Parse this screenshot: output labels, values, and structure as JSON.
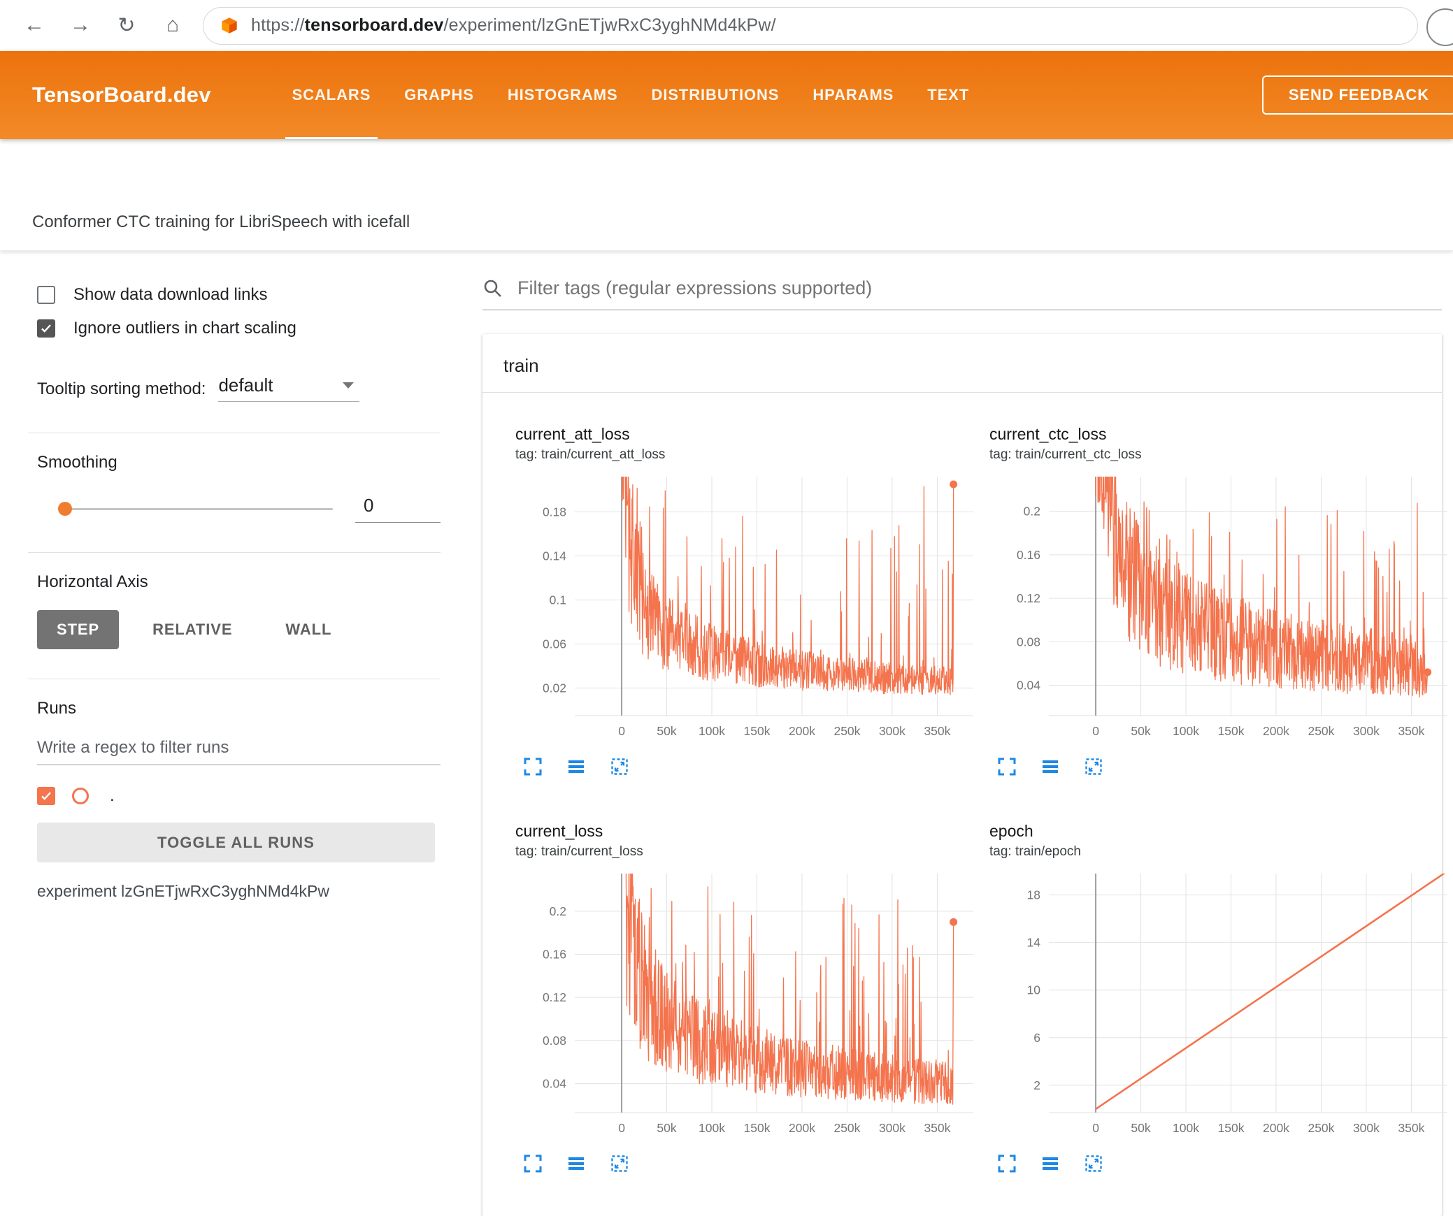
{
  "browser": {
    "back_glyph": "←",
    "forward_glyph": "→",
    "refresh_glyph": "↻",
    "home_glyph": "⌂",
    "url_scheme": "https://",
    "url_domain": "tensorboard.dev",
    "url_path": "/experiment/lzGnETjwRxC3yghNMd4kPw/"
  },
  "header": {
    "brand": "TensorBoard.dev",
    "tabs": [
      {
        "label": "SCALARS",
        "active": true
      },
      {
        "label": "GRAPHS",
        "active": false
      },
      {
        "label": "HISTOGRAMS",
        "active": false
      },
      {
        "label": "DISTRIBUTIONS",
        "active": false
      },
      {
        "label": "HPARAMS",
        "active": false
      },
      {
        "label": "TEXT",
        "active": false
      }
    ],
    "feedback_button": "SEND FEEDBACK"
  },
  "experiment_title": "Conformer CTC training for LibriSpeech with icefall",
  "sidebar": {
    "show_download_label": "Show data download links",
    "ignore_outliers_label": "Ignore outliers in chart scaling",
    "tooltip_sorting_label": "Tooltip sorting method:",
    "tooltip_sorting_value": "default",
    "smoothing_label": "Smoothing",
    "smoothing_value": "0",
    "horizontal_axis_label": "Horizontal Axis",
    "axis_modes": [
      "STEP",
      "RELATIVE",
      "WALL"
    ],
    "active_axis_mode": "STEP",
    "runs_label": "Runs",
    "runs_filter_placeholder": "Write a regex to filter runs",
    "run_item_label": ".",
    "toggle_all_runs_label": "TOGGLE ALL RUNS",
    "experiment_id_label": "experiment lzGnETjwRxC3yghNMd4kPw"
  },
  "main": {
    "filter_placeholder": "Filter tags (regular expressions supported)",
    "section_title": "train"
  },
  "colors": {
    "header_orange": "#ee7410",
    "series_orange": "#f4744e",
    "toolbar_icon_blue": "#1e88e5"
  },
  "chart_data": [
    {
      "type": "line",
      "title": "current_att_loss",
      "tag": "tag: train/current_att_loss",
      "x_tick_labels": [
        "0",
        "50k",
        "100k",
        "150k",
        "200k",
        "250k",
        "300k",
        "350k"
      ],
      "x_tick_values": [
        0,
        50000,
        100000,
        150000,
        200000,
        250000,
        300000,
        350000
      ],
      "xlim": [
        -52000,
        390000
      ],
      "y_tick_labels": [
        "0.02",
        "0.06",
        "0.1",
        "0.14",
        "0.18"
      ],
      "y_tick_values": [
        0.02,
        0.06,
        0.1,
        0.14,
        0.18
      ],
      "ylim": [
        -0.005,
        0.212
      ],
      "color": "#f4744e",
      "noisy": true,
      "seed": 42,
      "n_points": 900,
      "x_end": 368000,
      "baseline": [
        [
          0,
          0.3
        ],
        [
          6000,
          0.17
        ],
        [
          15000,
          0.11
        ],
        [
          30000,
          0.085
        ],
        [
          60000,
          0.065
        ],
        [
          100000,
          0.052
        ],
        [
          150000,
          0.042
        ],
        [
          200000,
          0.036
        ],
        [
          260000,
          0.031
        ],
        [
          320000,
          0.028
        ],
        [
          368000,
          0.026
        ]
      ],
      "noise_frac": 0.5,
      "spike_prob": 0.08,
      "spike_max": 0.205,
      "end_marker": [
        368000,
        0.205
      ]
    },
    {
      "type": "line",
      "title": "current_ctc_loss",
      "tag": "tag: train/current_ctc_loss",
      "x_tick_labels": [
        "0",
        "50k",
        "100k",
        "150k",
        "200k",
        "250k",
        "300k",
        "350k"
      ],
      "x_tick_values": [
        0,
        50000,
        100000,
        150000,
        200000,
        250000,
        300000,
        350000
      ],
      "xlim": [
        -52000,
        390000
      ],
      "y_tick_labels": [
        "0.04",
        "0.08",
        "0.12",
        "0.16",
        "0.2"
      ],
      "y_tick_values": [
        0.04,
        0.08,
        0.12,
        0.16,
        0.2
      ],
      "ylim": [
        0.012,
        0.232
      ],
      "color": "#f4744e",
      "noisy": true,
      "seed": 7,
      "n_points": 900,
      "x_end": 368000,
      "baseline": [
        [
          0,
          0.34
        ],
        [
          6000,
          0.24
        ],
        [
          15000,
          0.185
        ],
        [
          30000,
          0.15
        ],
        [
          60000,
          0.12
        ],
        [
          100000,
          0.098
        ],
        [
          150000,
          0.083
        ],
        [
          200000,
          0.073
        ],
        [
          260000,
          0.066
        ],
        [
          320000,
          0.06
        ],
        [
          368000,
          0.056
        ]
      ],
      "noise_frac": 0.5,
      "spike_prob": 0.08,
      "spike_max": 0.21,
      "end_marker": [
        368000,
        0.052
      ]
    },
    {
      "type": "line",
      "title": "current_loss",
      "tag": "tag: train/current_loss",
      "x_tick_labels": [
        "0",
        "50k",
        "100k",
        "150k",
        "200k",
        "250k",
        "300k",
        "350k"
      ],
      "x_tick_values": [
        0,
        50000,
        100000,
        150000,
        200000,
        250000,
        300000,
        350000
      ],
      "xlim": [
        -52000,
        390000
      ],
      "y_tick_labels": [
        "0.04",
        "0.08",
        "0.12",
        "0.16",
        "0.2"
      ],
      "y_tick_values": [
        0.04,
        0.08,
        0.12,
        0.16,
        0.2
      ],
      "ylim": [
        0.013,
        0.235
      ],
      "color": "#f4744e",
      "noisy": true,
      "seed": 13,
      "n_points": 900,
      "x_end": 368000,
      "baseline": [
        [
          0,
          0.35
        ],
        [
          6000,
          0.21
        ],
        [
          15000,
          0.15
        ],
        [
          30000,
          0.115
        ],
        [
          60000,
          0.09
        ],
        [
          100000,
          0.073
        ],
        [
          150000,
          0.062
        ],
        [
          200000,
          0.054
        ],
        [
          260000,
          0.048
        ],
        [
          320000,
          0.043
        ],
        [
          368000,
          0.041
        ]
      ],
      "noise_frac": 0.5,
      "spike_prob": 0.08,
      "spike_max": 0.225,
      "end_marker": [
        368000,
        0.19
      ]
    },
    {
      "type": "line",
      "title": "epoch",
      "tag": "tag: train/epoch",
      "x_tick_labels": [
        "0",
        "50k",
        "100k",
        "150k",
        "200k",
        "250k",
        "300k",
        "350k"
      ],
      "x_tick_values": [
        0,
        50000,
        100000,
        150000,
        200000,
        250000,
        300000,
        350000
      ],
      "xlim": [
        -52000,
        390000
      ],
      "y_tick_labels": [
        "2",
        "6",
        "10",
        "14",
        "18"
      ],
      "y_tick_values": [
        2,
        6,
        10,
        14,
        18
      ],
      "ylim": [
        -0.3,
        19.8
      ],
      "color": "#f4744e",
      "noisy": false,
      "points": [
        [
          0,
          0
        ],
        [
          390000,
          20.0
        ]
      ]
    }
  ]
}
